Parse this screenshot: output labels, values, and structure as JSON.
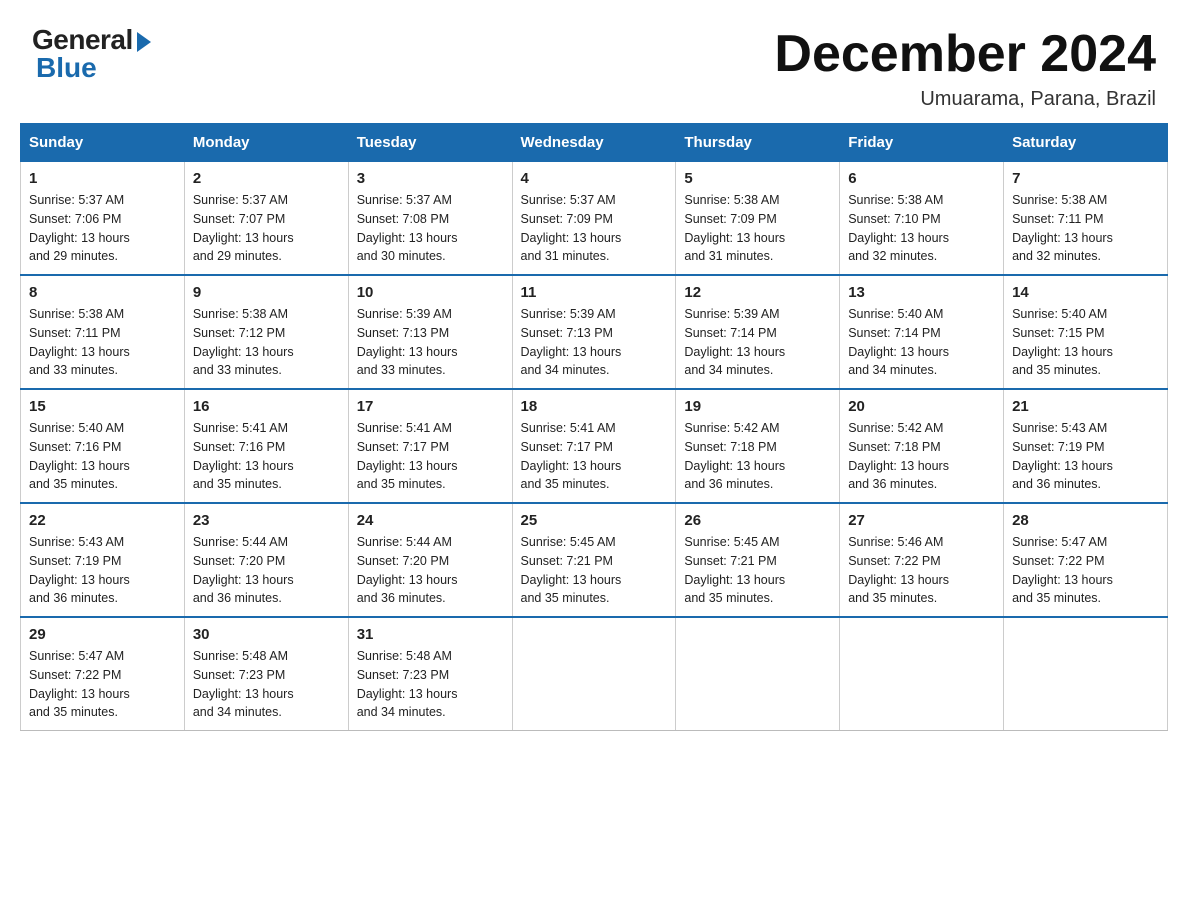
{
  "header": {
    "logo_general": "General",
    "logo_blue": "Blue",
    "month_year": "December 2024",
    "location": "Umuarama, Parana, Brazil"
  },
  "weekdays": [
    "Sunday",
    "Monday",
    "Tuesday",
    "Wednesday",
    "Thursday",
    "Friday",
    "Saturday"
  ],
  "weeks": [
    [
      {
        "day": "1",
        "sunrise": "5:37 AM",
        "sunset": "7:06 PM",
        "daylight": "13 hours and 29 minutes."
      },
      {
        "day": "2",
        "sunrise": "5:37 AM",
        "sunset": "7:07 PM",
        "daylight": "13 hours and 29 minutes."
      },
      {
        "day": "3",
        "sunrise": "5:37 AM",
        "sunset": "7:08 PM",
        "daylight": "13 hours and 30 minutes."
      },
      {
        "day": "4",
        "sunrise": "5:37 AM",
        "sunset": "7:09 PM",
        "daylight": "13 hours and 31 minutes."
      },
      {
        "day": "5",
        "sunrise": "5:38 AM",
        "sunset": "7:09 PM",
        "daylight": "13 hours and 31 minutes."
      },
      {
        "day": "6",
        "sunrise": "5:38 AM",
        "sunset": "7:10 PM",
        "daylight": "13 hours and 32 minutes."
      },
      {
        "day": "7",
        "sunrise": "5:38 AM",
        "sunset": "7:11 PM",
        "daylight": "13 hours and 32 minutes."
      }
    ],
    [
      {
        "day": "8",
        "sunrise": "5:38 AM",
        "sunset": "7:11 PM",
        "daylight": "13 hours and 33 minutes."
      },
      {
        "day": "9",
        "sunrise": "5:38 AM",
        "sunset": "7:12 PM",
        "daylight": "13 hours and 33 minutes."
      },
      {
        "day": "10",
        "sunrise": "5:39 AM",
        "sunset": "7:13 PM",
        "daylight": "13 hours and 33 minutes."
      },
      {
        "day": "11",
        "sunrise": "5:39 AM",
        "sunset": "7:13 PM",
        "daylight": "13 hours and 34 minutes."
      },
      {
        "day": "12",
        "sunrise": "5:39 AM",
        "sunset": "7:14 PM",
        "daylight": "13 hours and 34 minutes."
      },
      {
        "day": "13",
        "sunrise": "5:40 AM",
        "sunset": "7:14 PM",
        "daylight": "13 hours and 34 minutes."
      },
      {
        "day": "14",
        "sunrise": "5:40 AM",
        "sunset": "7:15 PM",
        "daylight": "13 hours and 35 minutes."
      }
    ],
    [
      {
        "day": "15",
        "sunrise": "5:40 AM",
        "sunset": "7:16 PM",
        "daylight": "13 hours and 35 minutes."
      },
      {
        "day": "16",
        "sunrise": "5:41 AM",
        "sunset": "7:16 PM",
        "daylight": "13 hours and 35 minutes."
      },
      {
        "day": "17",
        "sunrise": "5:41 AM",
        "sunset": "7:17 PM",
        "daylight": "13 hours and 35 minutes."
      },
      {
        "day": "18",
        "sunrise": "5:41 AM",
        "sunset": "7:17 PM",
        "daylight": "13 hours and 35 minutes."
      },
      {
        "day": "19",
        "sunrise": "5:42 AM",
        "sunset": "7:18 PM",
        "daylight": "13 hours and 36 minutes."
      },
      {
        "day": "20",
        "sunrise": "5:42 AM",
        "sunset": "7:18 PM",
        "daylight": "13 hours and 36 minutes."
      },
      {
        "day": "21",
        "sunrise": "5:43 AM",
        "sunset": "7:19 PM",
        "daylight": "13 hours and 36 minutes."
      }
    ],
    [
      {
        "day": "22",
        "sunrise": "5:43 AM",
        "sunset": "7:19 PM",
        "daylight": "13 hours and 36 minutes."
      },
      {
        "day": "23",
        "sunrise": "5:44 AM",
        "sunset": "7:20 PM",
        "daylight": "13 hours and 36 minutes."
      },
      {
        "day": "24",
        "sunrise": "5:44 AM",
        "sunset": "7:20 PM",
        "daylight": "13 hours and 36 minutes."
      },
      {
        "day": "25",
        "sunrise": "5:45 AM",
        "sunset": "7:21 PM",
        "daylight": "13 hours and 35 minutes."
      },
      {
        "day": "26",
        "sunrise": "5:45 AM",
        "sunset": "7:21 PM",
        "daylight": "13 hours and 35 minutes."
      },
      {
        "day": "27",
        "sunrise": "5:46 AM",
        "sunset": "7:22 PM",
        "daylight": "13 hours and 35 minutes."
      },
      {
        "day": "28",
        "sunrise": "5:47 AM",
        "sunset": "7:22 PM",
        "daylight": "13 hours and 35 minutes."
      }
    ],
    [
      {
        "day": "29",
        "sunrise": "5:47 AM",
        "sunset": "7:22 PM",
        "daylight": "13 hours and 35 minutes."
      },
      {
        "day": "30",
        "sunrise": "5:48 AM",
        "sunset": "7:23 PM",
        "daylight": "13 hours and 34 minutes."
      },
      {
        "day": "31",
        "sunrise": "5:48 AM",
        "sunset": "7:23 PM",
        "daylight": "13 hours and 34 minutes."
      },
      null,
      null,
      null,
      null
    ]
  ]
}
